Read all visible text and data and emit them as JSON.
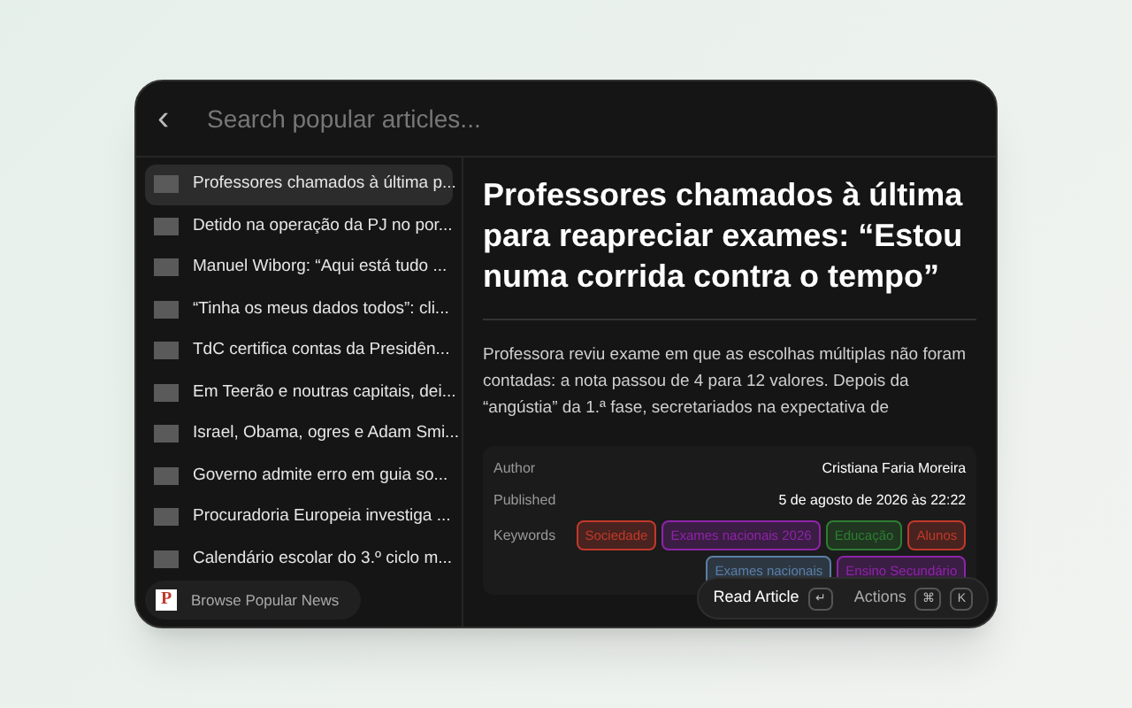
{
  "search": {
    "back": "‹",
    "placeholder": "Search popular articles..."
  },
  "articles": [
    {
      "title": "Professores chamados à última p...",
      "selected": true
    },
    {
      "title": "Detido na operação da PJ no por...",
      "selected": false
    },
    {
      "title": "Manuel Wiborg: “Aqui está tudo ...",
      "selected": false
    },
    {
      "title": "“Tinha os meus dados todos”: cli...",
      "selected": false
    },
    {
      "title": "TdC certifica contas da Presidên...",
      "selected": false
    },
    {
      "title": "Em Teerão e noutras capitais, dei...",
      "selected": false
    },
    {
      "title": "Israel, Obama, ogres e Adam Smi...",
      "selected": false
    },
    {
      "title": "Governo admite erro em guia so...",
      "selected": false
    },
    {
      "title": "Procuradoria Europeia investiga ...",
      "selected": false
    },
    {
      "title": "Calendário escolar do 3.º ciclo m...",
      "selected": false
    }
  ],
  "source": {
    "logo": "P",
    "label": "Browse Popular News"
  },
  "detail": {
    "title": "Professores chamados à última para reapreciar exames: “Estou numa corrida contra o tempo”",
    "summary": "Professora reviu exame em que as escolhas múltiplas não foram contadas: a nota passou de 4 para 12 valores. Depois da “angústia” da 1.ª fase, secretariados na expectativa de",
    "metadata": [
      {
        "label": "Author",
        "value": "Cristiana Faria Moreira"
      },
      {
        "label": "Published",
        "value": "5 de agosto de 2026 às 22:22"
      }
    ],
    "keywords_label": "Keywords",
    "keywords": [
      {
        "text": "Sociedade",
        "color": "#c0392b"
      },
      {
        "text": "Exames nacionais 2026",
        "color": "#8e24aa"
      },
      {
        "text": "Educação",
        "color": "#2e7d32"
      },
      {
        "text": "Alunos",
        "color": "#c0392b"
      },
      {
        "text": "Exames nacionais",
        "color": "#5b7fa6"
      },
      {
        "text": "Ensino Secundário",
        "color": "#8e24aa"
      }
    ]
  },
  "actions": [
    {
      "label": "Read Article",
      "keys": [
        "↵"
      ],
      "primary": true
    },
    {
      "label": "Actions",
      "keys": [
        "⌘",
        "K"
      ],
      "primary": false
    }
  ]
}
